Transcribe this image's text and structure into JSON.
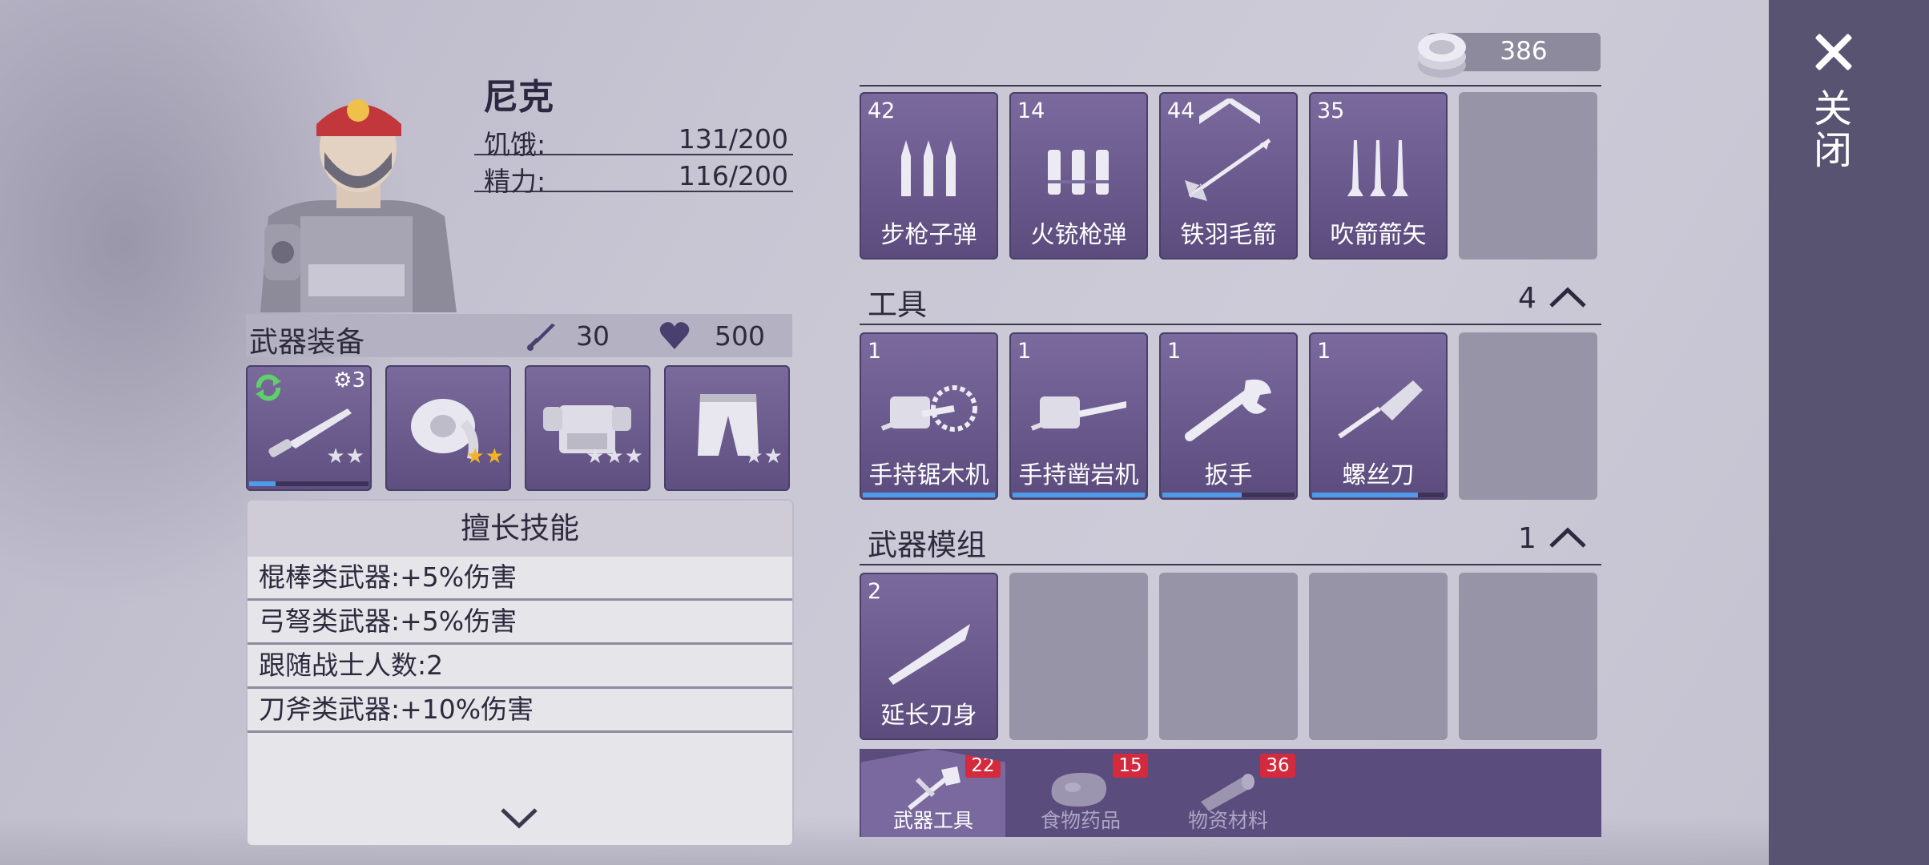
{
  "close": {
    "label": "关闭"
  },
  "coins": {
    "value": "386"
  },
  "character": {
    "name": "尼克",
    "stats": [
      {
        "label": "饥饿:",
        "value": "131/200"
      },
      {
        "label": "精力:",
        "value": "116/200"
      }
    ]
  },
  "equipment": {
    "title": "武器装备",
    "attack": "30",
    "health": "500",
    "slots": [
      {
        "icon": "knife-icon",
        "stars": 2,
        "star_color": "gray",
        "level": "3",
        "progress": 0.22
      },
      {
        "icon": "headband-icon",
        "stars": 2,
        "star_color": "gold"
      },
      {
        "icon": "armor-vest-icon",
        "stars": 3,
        "star_color": "gray"
      },
      {
        "icon": "pants-icon",
        "stars": 2,
        "star_color": "gray"
      }
    ]
  },
  "skills": {
    "title": "擅长技能",
    "items": [
      "棍棒类武器:+5%伤害",
      "弓弩类武器:+5%伤害",
      "跟随战士人数:2",
      "刀斧类武器:+10%伤害"
    ]
  },
  "ammo": {
    "items": [
      {
        "count": "42",
        "name": "步枪子弹",
        "icon": "rifle-bullets-icon"
      },
      {
        "count": "14",
        "name": "火铳枪弹",
        "icon": "shotgun-shells-icon"
      },
      {
        "count": "44",
        "name": "铁羽毛箭",
        "icon": "feather-arrow-icon"
      },
      {
        "count": "35",
        "name": "吹箭箭矢",
        "icon": "darts-icon"
      }
    ]
  },
  "tools": {
    "title": "工具",
    "count": "4",
    "items": [
      {
        "count": "1",
        "name": "手持锯木机",
        "icon": "chainsaw-icon",
        "progress": 1.0
      },
      {
        "count": "1",
        "name": "手持凿岩机",
        "icon": "rock-drill-icon",
        "progress": 1.0
      },
      {
        "count": "1",
        "name": "扳手",
        "icon": "wrench-icon",
        "progress": 0.6
      },
      {
        "count": "1",
        "name": "螺丝刀",
        "icon": "screwdriver-icon",
        "progress": 0.8
      }
    ]
  },
  "mods": {
    "title": "武器模组",
    "count": "1",
    "items": [
      {
        "count": "2",
        "name": "延长刀身",
        "icon": "blade-icon"
      }
    ]
  },
  "tabs": [
    {
      "label": "武器工具",
      "badge": "22",
      "icon": "axe-hammer-icon",
      "active": true
    },
    {
      "label": "食物药品",
      "badge": "15",
      "icon": "meat-icon",
      "active": false
    },
    {
      "label": "物资材料",
      "badge": "36",
      "icon": "logs-icon",
      "active": false
    }
  ]
}
